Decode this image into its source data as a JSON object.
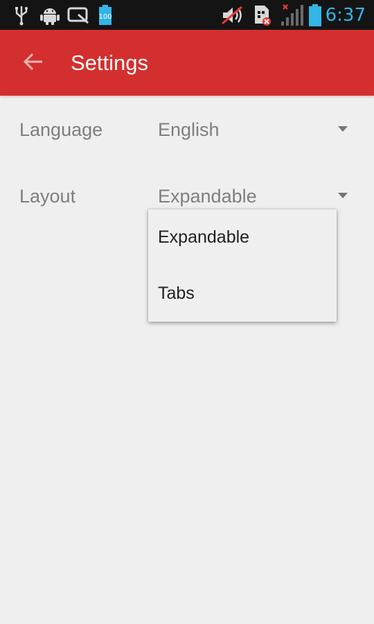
{
  "status_bar": {
    "time": "6:37",
    "battery_indicator_text": "100",
    "icons": [
      "usb-icon",
      "android-debug-icon",
      "screen-icon",
      "battery-small-icon",
      "mute-icon",
      "sim-error-icon",
      "signal-icon",
      "battery-icon"
    ],
    "time_color": "#33b5e5"
  },
  "app_bar": {
    "title": "Settings",
    "back_icon": "arrow-left-icon",
    "color": "#d32f2f"
  },
  "settings": {
    "language": {
      "label": "Language",
      "value": "English"
    },
    "layout": {
      "label": "Layout",
      "value": "Expandable"
    }
  },
  "dropdown": {
    "options": [
      "Expandable",
      "Tabs"
    ]
  }
}
